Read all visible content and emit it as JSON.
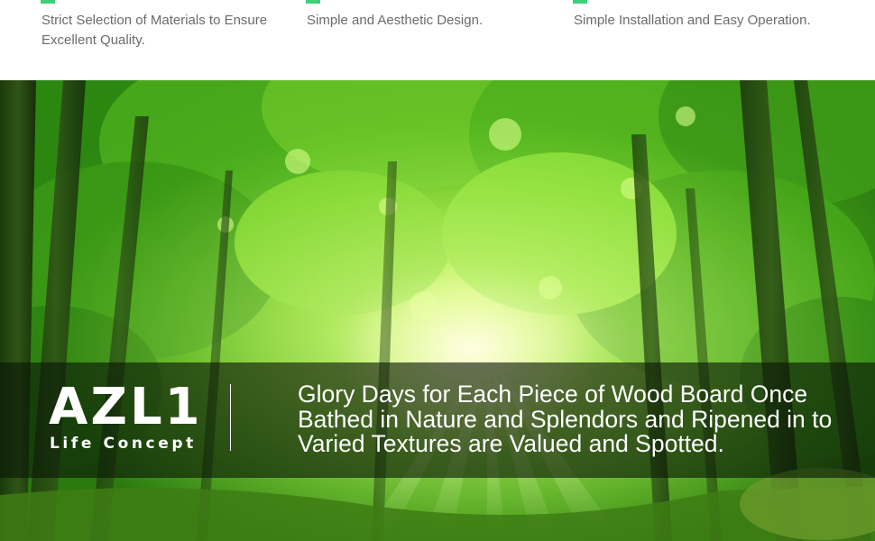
{
  "features": [
    {
      "text": "Strict Selection of Materials to Ensure Excellent Quality."
    },
    {
      "text": "Simple and Aesthetic Design."
    },
    {
      "text": "Simple Installation and Easy Operation."
    }
  ],
  "banner": {
    "brand": "AZL1",
    "subtitle": "Life Concept",
    "tagline": "Glory Days for Each Piece of Wood Board Once Bathed in Nature and Splendors and Ripened in to Varied Textures are Valued and Spotted."
  },
  "colors": {
    "accent": "#3dcf7a",
    "feature_text": "#6b6b6b",
    "band_overlay": "rgba(10,22,6,0.62)",
    "banner_text": "#ffffff"
  }
}
